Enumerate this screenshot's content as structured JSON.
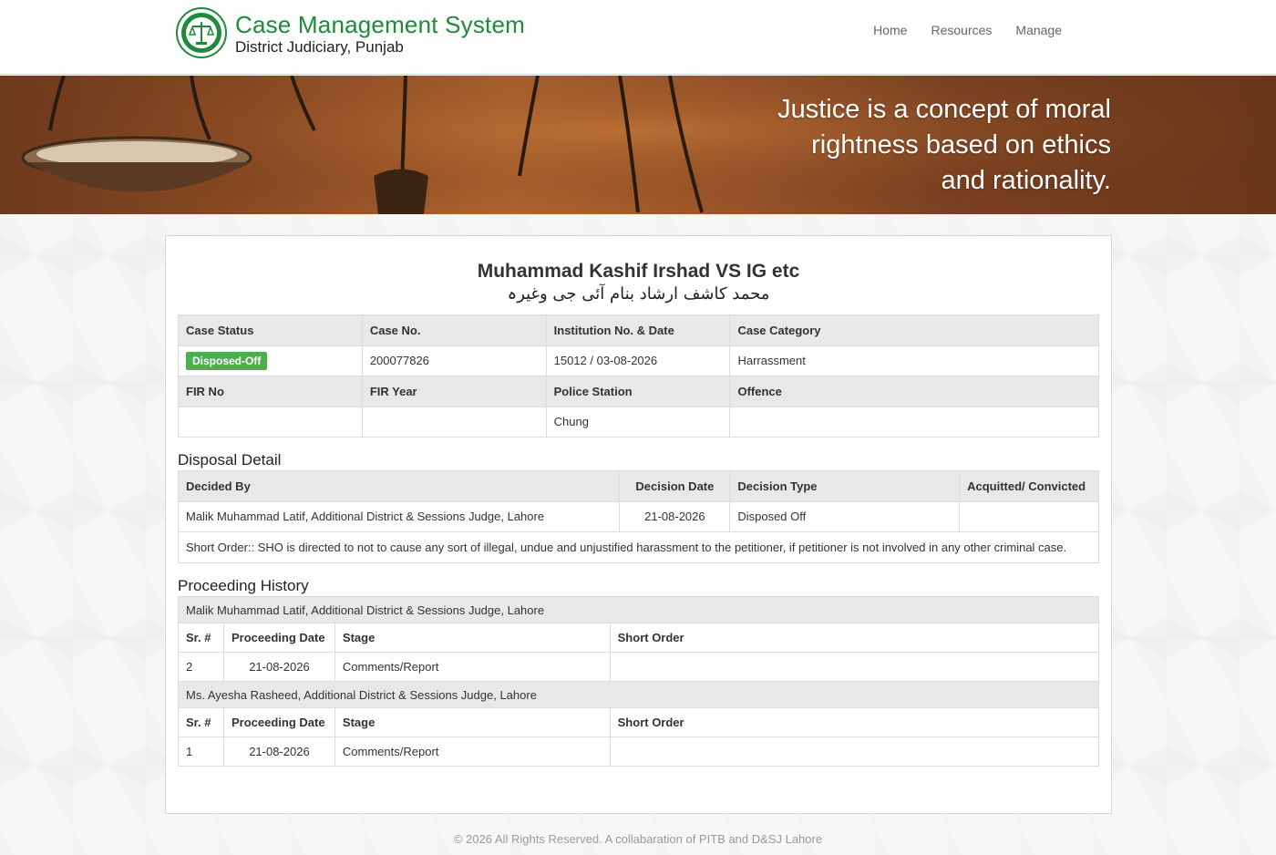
{
  "header": {
    "title": "Case Management System",
    "subtitle": "District Judiciary, Punjab",
    "nav": [
      "Home",
      "Resources",
      "Manage"
    ]
  },
  "banner": {
    "quote_lines": [
      "Justice is a concept of moral",
      "rightness based on ethics",
      "and rationality."
    ]
  },
  "case": {
    "title": "Muhammad Kashif Irshad VS IG etc",
    "title_urdu": "محمد کاشف ارشاد بنام آئی جی وغیرہ",
    "headers1": [
      "Case Status",
      "Case No.",
      "Institution No. & Date",
      "Case Category"
    ],
    "status": "Disposed-Off",
    "case_no": "200077826",
    "institution": "15012 / 03-08-2026",
    "category": "Harrassment",
    "headers2": [
      "FIR No",
      "FIR Year",
      "Police Station",
      "Offence"
    ],
    "fir_no": "",
    "fir_year": "",
    "police_station": "Chung",
    "offence": ""
  },
  "disposal": {
    "section_title": "Disposal Detail",
    "headers": [
      "Decided By",
      "Decision Date",
      "Decision Type",
      "Acquitted/ Convicted"
    ],
    "decided_by": "Malik Muhammad Latif, Additional District & Sessions Judge, Lahore",
    "decision_date": "21-08-2026",
    "decision_type": "Disposed Off",
    "acquitted": "",
    "short_order": "Short Order:: SHO is directed to not to cause any sort of illegal, undue and unjustified harassment to the petitioner, if petitioner is not involved in any other criminal case."
  },
  "proceedings": {
    "section_title": "Proceeding History",
    "headers": [
      "Sr. #",
      "Proceeding Date",
      "Stage",
      "Short Order"
    ],
    "groups": [
      {
        "judge": "Malik Muhammad Latif, Additional District & Sessions Judge, Lahore",
        "rows": [
          {
            "sr": "2",
            "date": "21-08-2026",
            "stage": "Comments/Report",
            "order": ""
          }
        ]
      },
      {
        "judge": "Ms. Ayesha Rasheed, Additional District & Sessions Judge, Lahore",
        "rows": [
          {
            "sr": "1",
            "date": "21-08-2026",
            "stage": "Comments/Report",
            "order": ""
          }
        ]
      }
    ]
  },
  "footer": {
    "text": "© 2026 All Rights Reserved. A collabaration of PITB and D&SJ Lahore"
  },
  "colors": {
    "brand_green": "#1f8a3a",
    "badge_green": "#4cae4c",
    "table_header": "#e8e8e8"
  }
}
